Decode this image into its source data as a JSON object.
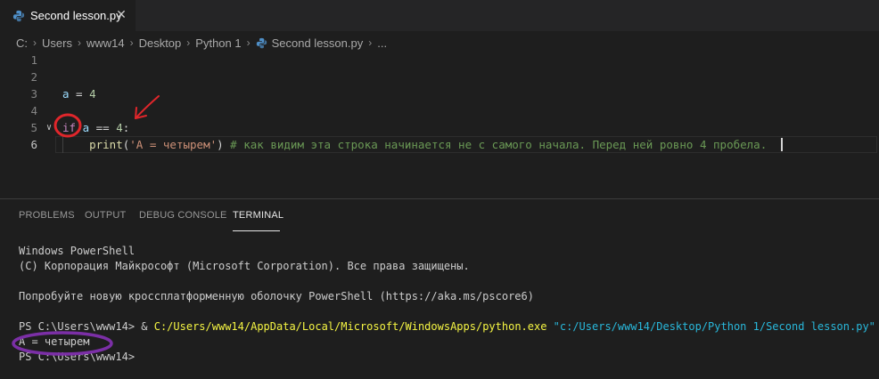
{
  "tab": {
    "label": "Second lesson.py",
    "close": "✕"
  },
  "breadcrumb": {
    "items": [
      "C:",
      "Users",
      "www14",
      "Desktop",
      "Python 1",
      "Second lesson.py",
      "..."
    ],
    "separator": "›"
  },
  "editor": {
    "line_numbers": [
      "1",
      "2",
      "3",
      "4",
      "5",
      "6"
    ],
    "line3": {
      "var": "a",
      "op": " = ",
      "num": "4"
    },
    "line5": {
      "kw": "if",
      "var": " a",
      "op": " == ",
      "num": "4",
      "colon": ":"
    },
    "line6": {
      "indent": "    ",
      "fn": "print",
      "open": "(",
      "str": "'A = четырем'",
      "close": ")",
      "comment": " # как видим эта строка начинается не с самого начала. Перед ней ровно 4 пробела."
    },
    "fold_icon": "chevron-down-icon"
  },
  "panel": {
    "tabs": [
      "PROBLEMS",
      "OUTPUT",
      "DEBUG CONSOLE",
      "TERMINAL"
    ],
    "active_tab": "TERMINAL"
  },
  "terminal": {
    "l1": "Windows PowerShell",
    "l2": "(C) Корпорация Майкрософт (Microsoft Corporation). Все права защищены.",
    "l3": "Попробуйте новую кроссплатформенную оболочку PowerShell (https://aka.ms/pscore6)",
    "prompt": "PS C:\\Users\\www14> ",
    "amp": "& ",
    "exe": "C:/Users/www14/AppData/Local/Microsoft/WindowsApps/python.exe",
    "arg": " \"c:/Users/www14/Desktop/Python 1/Second lesson.py\"",
    "output": "A = четырем",
    "prompt2": "PS C:\\Users\\www14>"
  },
  "colors": {
    "background": "#1e1e1e",
    "keyword": "#c586c0",
    "string": "#ce9178",
    "comment": "#6a9955",
    "annotation_red": "#e0262b",
    "annotation_purple": "#7b2fa6"
  }
}
